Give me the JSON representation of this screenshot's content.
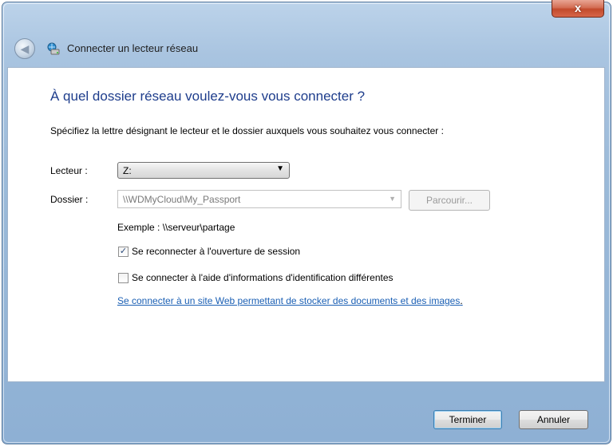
{
  "window": {
    "title": "Connecter un lecteur réseau",
    "close_label": "x",
    "back_icon": "back-arrow-icon",
    "app_icon": "network-drive-icon"
  },
  "main": {
    "heading": "À quel dossier réseau voulez-vous vous connecter ?",
    "instruction": "Spécifiez la lettre désignant le lecteur et le dossier auxquels vous souhaitez vous connecter :",
    "drive_label": "Lecteur :",
    "drive_value": "Z:",
    "folder_label": "Dossier :",
    "folder_value": "\\\\WDMyCloud\\My_Passport",
    "browse_label": "Parcourir...",
    "example": "Exemple : \\\\serveur\\partage",
    "reconnect_label": "Se reconnecter à l'ouverture de session",
    "reconnect_checked": true,
    "credentials_label": "Se connecter à l'aide d'informations d'identification différentes",
    "credentials_checked": false,
    "web_link_label": "Se connecter à un site Web permettant de stocker des documents et des images",
    "web_link_suffix": "."
  },
  "footer": {
    "finish_label": "Terminer",
    "cancel_label": "Annuler"
  },
  "colors": {
    "heading": "#1e3d8c",
    "link": "#1a5fb4",
    "close_button": "#c24a2c",
    "frame": "#a9c4e0"
  }
}
